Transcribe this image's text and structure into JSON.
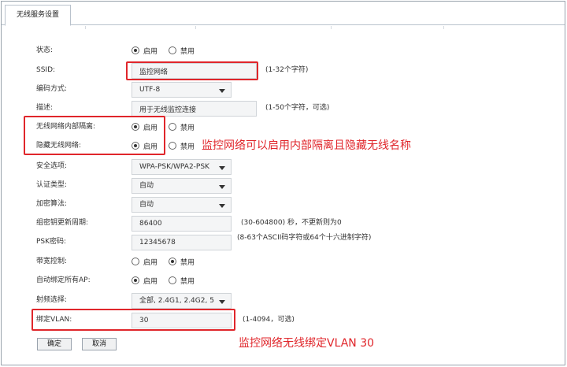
{
  "tab": {
    "label": "无线服务设置"
  },
  "form": {
    "status": {
      "label": "状态:",
      "opt_on": "启用",
      "opt_off": "禁用",
      "selected": "on"
    },
    "ssid": {
      "label": "SSID:",
      "value": "监控网络",
      "hint": "(1-32个字符)"
    },
    "encoding": {
      "label": "编码方式:",
      "value": "UTF-8"
    },
    "description": {
      "label": "描述:",
      "value": "用于无线监控连接",
      "hint": "(1-50个字符，可选)"
    },
    "isolation": {
      "label": "无线网络内部隔离:",
      "opt_on": "启用",
      "opt_off": "禁用",
      "selected": "on"
    },
    "hide_ssid": {
      "label": "隐藏无线网络:",
      "opt_on": "启用",
      "opt_off": "禁用",
      "selected": "on"
    },
    "security": {
      "label": "安全选项:",
      "value": "WPA-PSK/WPA2-PSK"
    },
    "auth_type": {
      "label": "认证类型:",
      "value": "自动"
    },
    "encryption": {
      "label": "加密算法:",
      "value": "自动"
    },
    "group_key": {
      "label": "组密钥更新周期:",
      "value": "86400",
      "hint": "(30-604800) 秒，不更新则为0"
    },
    "psk": {
      "label": "PSK密码:",
      "value": "12345678",
      "hint": "(8-63个ASCII码字符或64个十六进制字符)"
    },
    "bandwidth": {
      "label": "带宽控制:",
      "opt_on": "启用",
      "opt_off": "禁用",
      "selected": "off"
    },
    "auto_bind": {
      "label": "自动绑定所有AP:",
      "opt_on": "启用",
      "opt_off": "禁用",
      "selected": "on"
    },
    "radio_select": {
      "label": "射频选择:",
      "value": "全部, 2.4G1, 2.4G2, 5"
    },
    "vlan": {
      "label": "绑定VLAN:",
      "value": "30",
      "hint": "(1-4094，可选)"
    }
  },
  "buttons": {
    "ok": "确定",
    "cancel": "取消"
  },
  "annotations": {
    "hide_text": "监控网络可以启用内部隔离且隐藏无线名称",
    "vlan_text": "监控网络无线绑定VLAN 30",
    "color": "#e0262b"
  }
}
